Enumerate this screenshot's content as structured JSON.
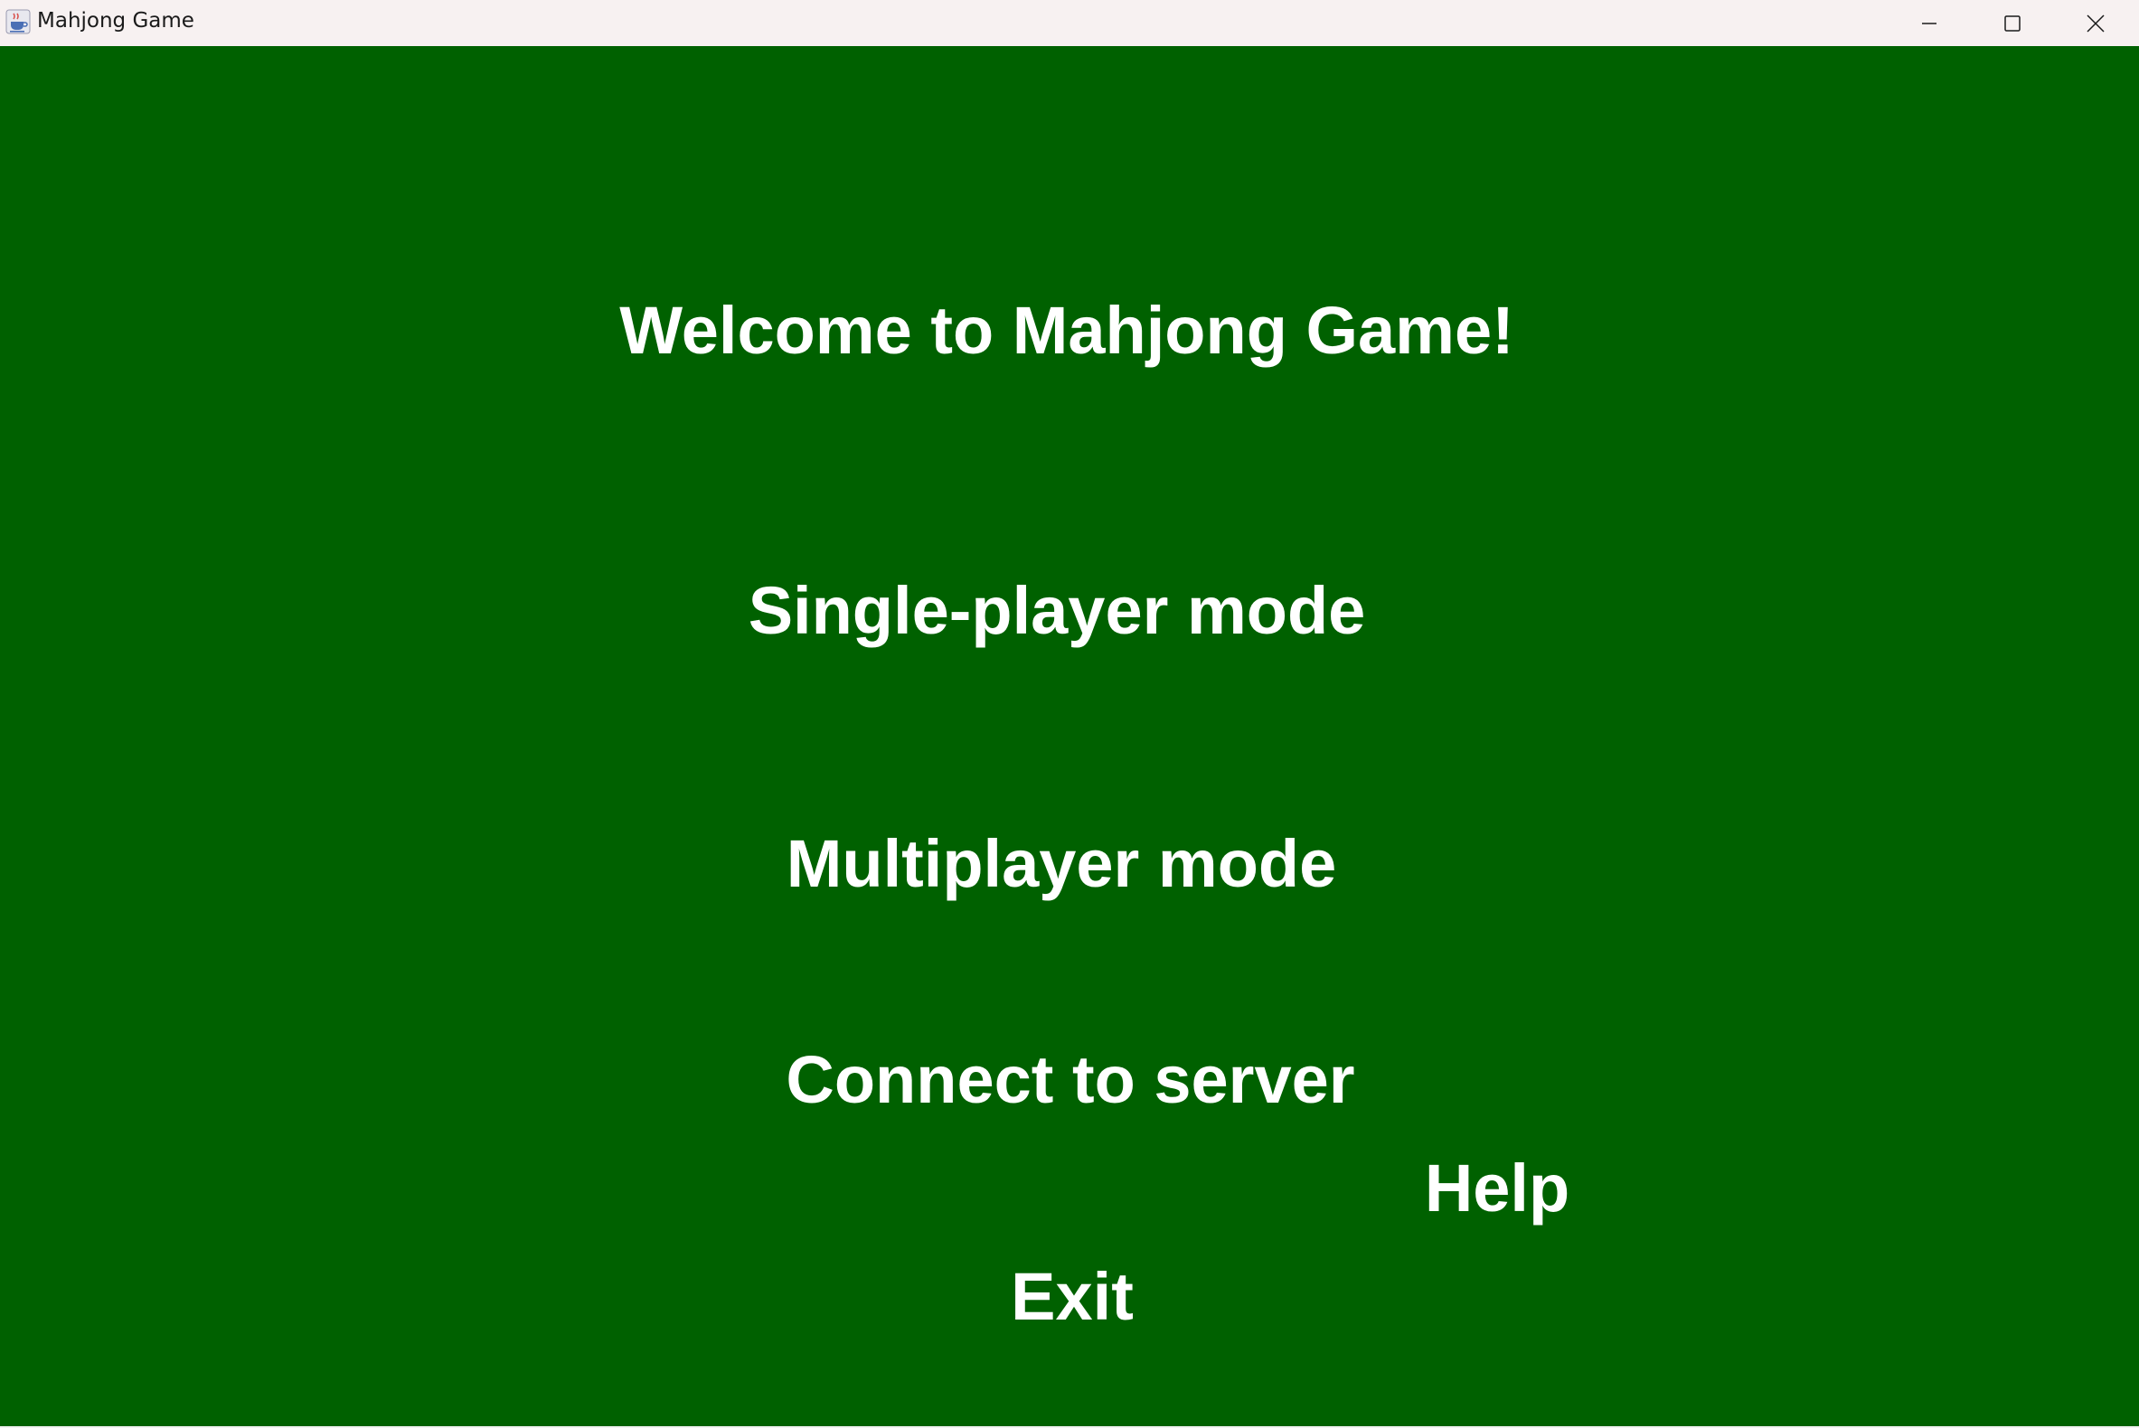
{
  "window": {
    "title": "Mahjong Game",
    "icon": "java-coffee-cup-icon"
  },
  "title_bar_buttons": {
    "minimize_icon": "minimize-icon",
    "maximize_icon": "maximize-icon",
    "close_icon": "close-icon"
  },
  "menu": {
    "welcome": "Welcome to Mahjong Game!",
    "single_player": "Single-player mode",
    "multiplayer": "Multiplayer mode",
    "connect": "Connect to server",
    "help": "Help",
    "exit": "Exit"
  },
  "colors": {
    "background": "#006100",
    "text": "#ffffff",
    "titlebar": "#f7f1f1"
  }
}
